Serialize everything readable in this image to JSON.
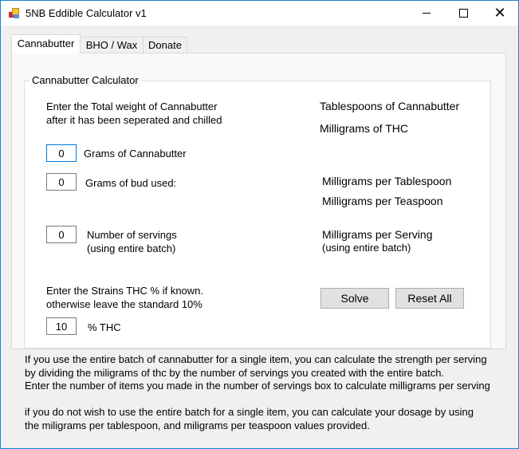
{
  "window": {
    "title": "5NB Eddible Calculator v1",
    "icon": "app-icon",
    "controls": {
      "minimize": "minimize-icon",
      "maximize": "maximize-icon",
      "close": "close-icon"
    }
  },
  "tabs": [
    {
      "label": "Cannabutter",
      "active": true
    },
    {
      "label": "BHO / Wax",
      "active": false
    },
    {
      "label": "Donate",
      "active": false
    }
  ],
  "group": {
    "title": "Cannabutter Calculator",
    "instruction_line1": "Enter the Total weight of Cannabutter",
    "instruction_line2": "after it has been seperated and chilled",
    "inputs": {
      "grams_butter": {
        "value": "0",
        "label": "Grams of Cannabutter"
      },
      "grams_bud": {
        "value": "0",
        "label": "Grams of bud used:"
      },
      "servings": {
        "value": "0",
        "label_line1": "Number of servings",
        "label_line2": "(using entire batch)"
      },
      "thc_instr_line1": "Enter the Strains THC % if known.",
      "thc_instr_line2": "otherwise leave the standard 10%",
      "thc": {
        "value": "10",
        "label": "% THC"
      }
    },
    "results": {
      "tablespoons": "Tablespoons of Cannabutter",
      "mg_thc": "Milligrams of THC",
      "mg_per_tbsp": "Milligrams per Tablespoon",
      "mg_per_tsp": "Milligrams per Teaspoon",
      "mg_per_serving_line1": "Milligrams per Serving",
      "mg_per_serving_line2": "(using entire batch)"
    },
    "buttons": {
      "solve": "Solve",
      "reset": "Reset All"
    }
  },
  "help_text": "If you use the entire batch of cannabutter for a single item, you can calculate the strength per serving\nby dividing the miligrams of thc by the number of servings you created with the entire batch.\nEnter the number of items you made in the number of servings box to calculate milligrams per serving\n\nif you do not wish to use the entire batch for a single item, you can calculate your dosage by using\nthe miligrams per tablespoon, and miligrams per teaspoon values provided."
}
